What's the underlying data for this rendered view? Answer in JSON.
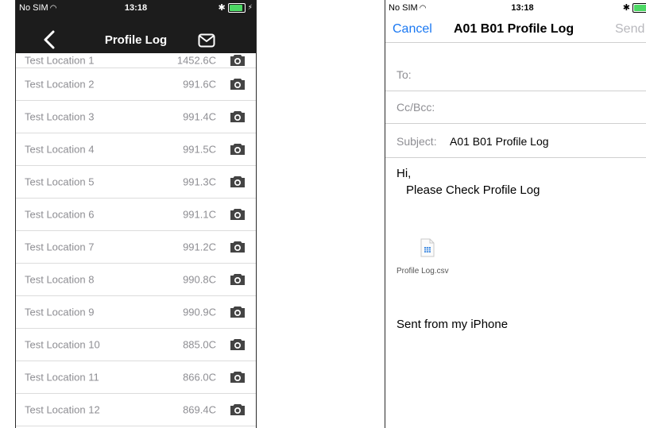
{
  "left": {
    "status": {
      "carrier": "No SIM",
      "time": "13:18",
      "battery_fill": 0.9
    },
    "nav": {
      "title": "Profile Log"
    },
    "rows": [
      {
        "location": "Test Location 1",
        "value": "1452.6C"
      },
      {
        "location": "Test Location 2",
        "value": "991.6C"
      },
      {
        "location": "Test Location 3",
        "value": "991.4C"
      },
      {
        "location": "Test Location 4",
        "value": "991.5C"
      },
      {
        "location": "Test Location 5",
        "value": "991.3C"
      },
      {
        "location": "Test Location 6",
        "value": "991.1C"
      },
      {
        "location": "Test Location 7",
        "value": "991.2C"
      },
      {
        "location": "Test Location 8",
        "value": "990.8C"
      },
      {
        "location": "Test Location 9",
        "value": "990.9C"
      },
      {
        "location": "Test Location 10",
        "value": "885.0C"
      },
      {
        "location": "Test Location 11",
        "value": "866.0C"
      },
      {
        "location": "Test Location 12",
        "value": "869.4C"
      }
    ]
  },
  "right": {
    "status": {
      "carrier": "No SIM",
      "time": "13:18"
    },
    "nav": {
      "cancel": "Cancel",
      "title": "A01 B01 Profile Log",
      "send": "Send"
    },
    "fields": {
      "to_label": "To:",
      "cc_label": "Cc/Bcc:",
      "subject_label": "Subject:",
      "subject_value": "A01 B01 Profile Log"
    },
    "body": {
      "greeting": "Hi,",
      "message": "Please Check Profile Log"
    },
    "attachment": {
      "name": "Profile Log.csv",
      "icon": "csv-file-icon"
    },
    "signature": "Sent from my iPhone"
  },
  "colors": {
    "nav_dark": "#1c1c1c",
    "ios_blue": "#1a78f2",
    "disabled_gray": "#b8b8bd",
    "battery_green": "#4cd964"
  },
  "icons": [
    "wifi-icon",
    "bluetooth-icon",
    "battery-icon",
    "back-chevron-icon",
    "mail-envelope-icon",
    "camera-icon",
    "csv-file-icon"
  ]
}
